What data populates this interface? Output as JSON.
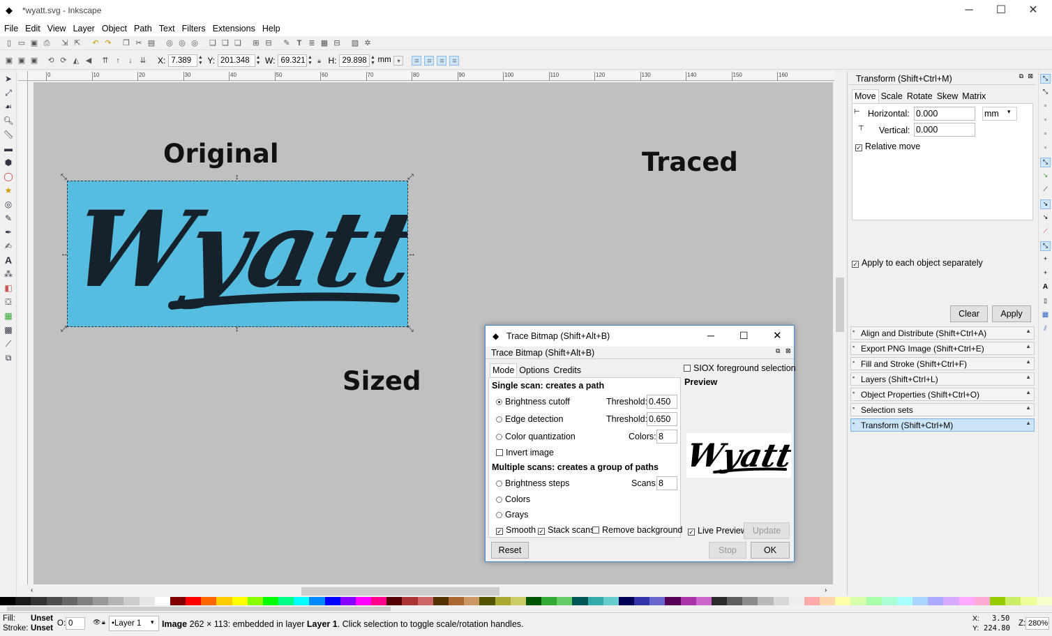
{
  "window": {
    "title": "*wyatt.svg - Inkscape"
  },
  "menu": [
    "File",
    "Edit",
    "View",
    "Layer",
    "Object",
    "Path",
    "Text",
    "Filters",
    "Extensions",
    "Help"
  ],
  "toolbar": {
    "x_label": "X:",
    "x_value": "7.389",
    "y_label": "Y:",
    "y_value": "201.348",
    "w_label": "W:",
    "w_value": "69.321",
    "h_label": "H:",
    "h_value": "29.898",
    "unit": "mm"
  },
  "ruler_ticks": [
    "0",
    "10",
    "20",
    "30",
    "40",
    "50",
    "60",
    "70",
    "80",
    "90",
    "100",
    "110",
    "120",
    "130",
    "140",
    "150",
    "160"
  ],
  "canvas": {
    "original_label": "Original",
    "traced_label": "Traced",
    "sized_label": "Sized",
    "image_text": "Wyatt",
    "image_bg": "#56bde0",
    "canvas_bg": "#c0c0c0"
  },
  "transform_panel": {
    "title": "Transform (Shift+Ctrl+M)",
    "tabs": [
      "Move",
      "Scale",
      "Rotate",
      "Skew",
      "Matrix"
    ],
    "horizontal_label": "Horizontal:",
    "horizontal_value": "0.000",
    "vertical_label": "Vertical:",
    "vertical_value": "0.000",
    "unit": "mm",
    "relative_move": "Relative move",
    "apply_each": "Apply to each object separately",
    "clear": "Clear",
    "apply": "Apply"
  },
  "dock_tabs": [
    "Align and Distribute (Shift+Ctrl+A)",
    "Export PNG Image (Shift+Ctrl+E)",
    "Fill and Stroke (Shift+Ctrl+F)",
    "Layers (Shift+Ctrl+L)",
    "Object Properties (Shift+Ctrl+O)",
    "Selection sets",
    "Transform (Shift+Ctrl+M)"
  ],
  "trace_dialog": {
    "window_title": "Trace Bitmap (Shift+Alt+B)",
    "inner_title": "Trace Bitmap (Shift+Alt+B)",
    "tabs": [
      "Mode",
      "Options",
      "Credits"
    ],
    "single_scan_heading": "Single scan: creates a path",
    "brightness_cutoff": "Brightness cutoff",
    "edge_detection": "Edge detection",
    "color_quantization": "Color quantization",
    "invert_image": "Invert image",
    "threshold_label": "Threshold:",
    "threshold1": "0.450",
    "threshold2": "0.650",
    "colors_label": "Colors:",
    "colors_value": "8",
    "multiple_scans_heading": "Multiple scans: creates a group of paths",
    "brightness_steps": "Brightness steps",
    "scans_label": "Scans:",
    "scans_value": "8",
    "colors_option": "Colors",
    "grays_option": "Grays",
    "smooth": "Smooth",
    "stack_scans": "Stack scans",
    "remove_background": "Remove background",
    "siox": "SIOX foreground selection",
    "preview_label": "Preview",
    "preview_text": "Wyatt",
    "live_preview": "Live Preview",
    "update": "Update",
    "reset": "Reset",
    "stop": "Stop",
    "ok": "OK"
  },
  "status": {
    "fill_label": "Fill:",
    "fill_value": "Unset",
    "stroke_label": "Stroke:",
    "stroke_value": "Unset",
    "opacity_label": "O:",
    "opacity_value": "0",
    "layer": "•Layer 1",
    "message_prefix": "Image",
    "message_mid": " 262 × 113: embedded in layer ",
    "message_layer": "Layer 1",
    "message_suffix": ". Click selection to toggle scale/rotation handles.",
    "x_label": "X:",
    "x_value": "3.50",
    "y_label": "Y:",
    "y_value": "224.80",
    "z_label": "Z:",
    "zoom": "280%"
  },
  "palette": [
    "#000000",
    "#1a1a1a",
    "#333333",
    "#4d4d4d",
    "#666666",
    "#808080",
    "#999999",
    "#b3b3b3",
    "#cccccc",
    "#e6e6e6",
    "#ffffff",
    "#800000",
    "#ff0000",
    "#ff6600",
    "#ffcc00",
    "#ffff00",
    "#88ff00",
    "#00ff00",
    "#00ff88",
    "#00ffff",
    "#0088ff",
    "#0000ff",
    "#8800ff",
    "#ff00ff",
    "#ff0088",
    "#550000",
    "#aa3333",
    "#cc6666",
    "#553300",
    "#aa6633",
    "#cc9966",
    "#555500",
    "#aaaa33",
    "#cccc66",
    "#005500",
    "#33aa33",
    "#66cc66",
    "#005555",
    "#33aaaa",
    "#66cccc",
    "#000055",
    "#3333aa",
    "#6666cc",
    "#550055",
    "#aa33aa",
    "#cc66cc",
    "#2b2b2b",
    "#5e5e5e",
    "#8c8c8c",
    "#b9b9b9",
    "#d8d8d8",
    "#efefef",
    "#ffaaaa",
    "#ffd5aa",
    "#ffffaa",
    "#d5ffaa",
    "#aaffaa",
    "#aaffd5",
    "#aaffff",
    "#aad5ff",
    "#aaaaff",
    "#d5aaff",
    "#ffaaff",
    "#ffaad5",
    "#99cc00",
    "#ccee66",
    "#eeff99",
    "#f5ffcc"
  ]
}
